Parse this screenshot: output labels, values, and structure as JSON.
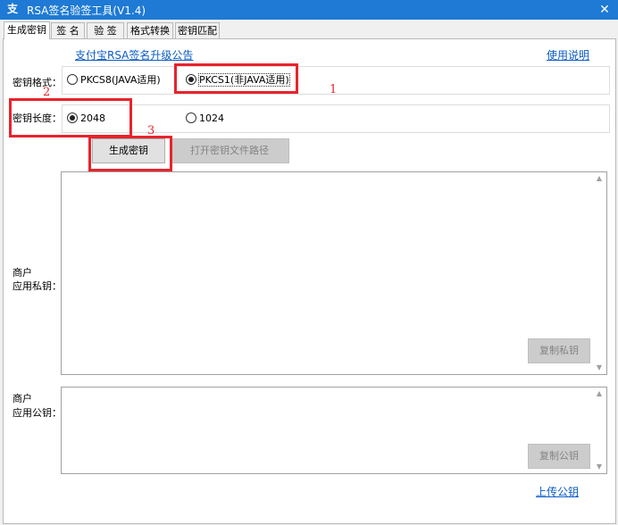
{
  "window": {
    "title": "RSA签名验签工具(V1.4)",
    "app_icon": "支",
    "close_symbol": "✕"
  },
  "tabs": [
    {
      "label": "生成密钥",
      "active": true
    },
    {
      "label": "签  名",
      "active": false
    },
    {
      "label": "验  签",
      "active": false
    },
    {
      "label": "格式转换",
      "active": false
    },
    {
      "label": "密钥匹配",
      "active": false
    }
  ],
  "links": {
    "announcement": "支付宝RSA签名升级公告",
    "help": "使用说明",
    "upload_public_key": "上传公钥"
  },
  "key_format": {
    "label": "密钥格式：",
    "options": [
      {
        "label": "PKCS8(JAVA适用)",
        "checked": false
      },
      {
        "label": "PKCS1(非JAVA适用)",
        "checked": true
      }
    ]
  },
  "key_length": {
    "label": "密钥长度：",
    "options": [
      {
        "label": "2048",
        "checked": true
      },
      {
        "label": "1024",
        "checked": false
      }
    ]
  },
  "buttons": {
    "generate": "生成密钥",
    "open_path": "打开密钥文件路径",
    "copy_private": "复制私钥",
    "copy_public": "复制公钥"
  },
  "private_key": {
    "label_line1": "商户",
    "label_line2": "应用私钥：",
    "value": ""
  },
  "public_key": {
    "label_line1": "商户",
    "label_line2": "应用公钥：",
    "value": ""
  },
  "annotations": [
    "1",
    "2",
    "3"
  ],
  "colors": {
    "titlebar": "#1e7ad4",
    "link": "#0b5cc4",
    "annotation": "#e8232c"
  }
}
